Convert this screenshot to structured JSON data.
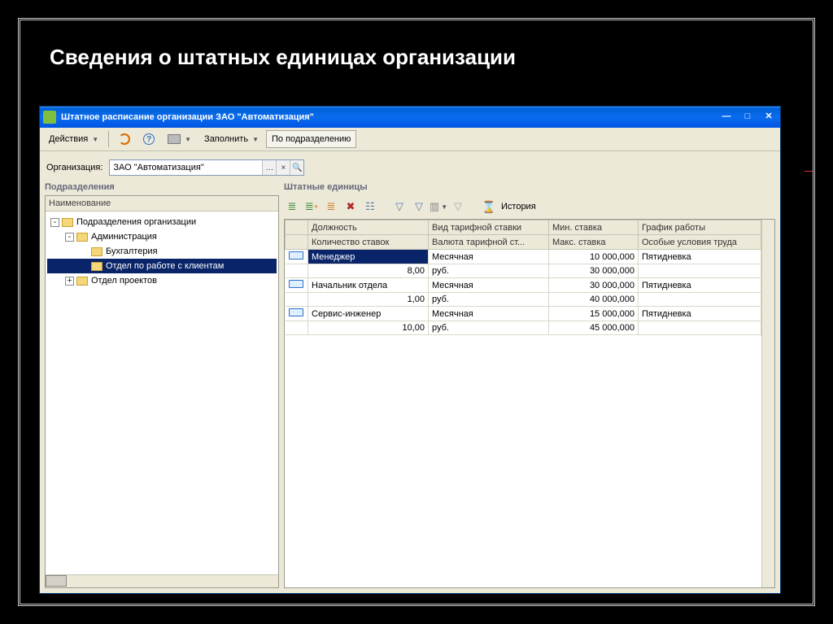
{
  "slide": {
    "title": "Сведения о штатных единицах организации"
  },
  "window": {
    "title": "Штатное расписание организации ЗАО \"Автоматизация\""
  },
  "toolbar": {
    "actions": "Действия",
    "fill": "Заполнить",
    "by_dept": "По подразделению"
  },
  "form": {
    "org_label": "Организация:",
    "org_value": "ЗАО \"Автоматизация\""
  },
  "left": {
    "title": "Подразделения",
    "header": "Наименование",
    "tree": [
      {
        "label": "Подразделения организации",
        "indent": 0,
        "exp": "-"
      },
      {
        "label": "Администрация",
        "indent": 1,
        "exp": "-"
      },
      {
        "label": "Бухгалтерия",
        "indent": 2,
        "exp": ""
      },
      {
        "label": "Отдел по работе с клиентам",
        "indent": 2,
        "exp": "",
        "selected": true
      },
      {
        "label": "Отдел проектов",
        "indent": 1,
        "exp": "+"
      }
    ]
  },
  "right": {
    "title": "Штатные единицы",
    "history": "История",
    "headers1": [
      "",
      "Должность",
      "Вид тарифной ставки",
      "Мин. ставка",
      "График работы"
    ],
    "headers2": [
      "",
      "Количество ставок",
      "Валюта тарифной ст...",
      "Макс. ставка",
      "Особые условия труда"
    ],
    "rows": [
      {
        "pos": "Менеджер",
        "type": "Месячная",
        "min": "10 000,000",
        "sched": "Пятидневка",
        "qty": "8,00",
        "cur": "руб.",
        "max": "30 000,000",
        "selected": true
      },
      {
        "pos": "Начальник отдела",
        "type": "Месячная",
        "min": "30 000,000",
        "sched": "Пятидневка",
        "qty": "1,00",
        "cur": "руб.",
        "max": "40 000,000"
      },
      {
        "pos": "Сервис-инженер",
        "type": "Месячная",
        "min": "15 000,000",
        "sched": "Пятидневка",
        "qty": "10,00",
        "cur": "руб.",
        "max": "45 000,000"
      }
    ]
  }
}
